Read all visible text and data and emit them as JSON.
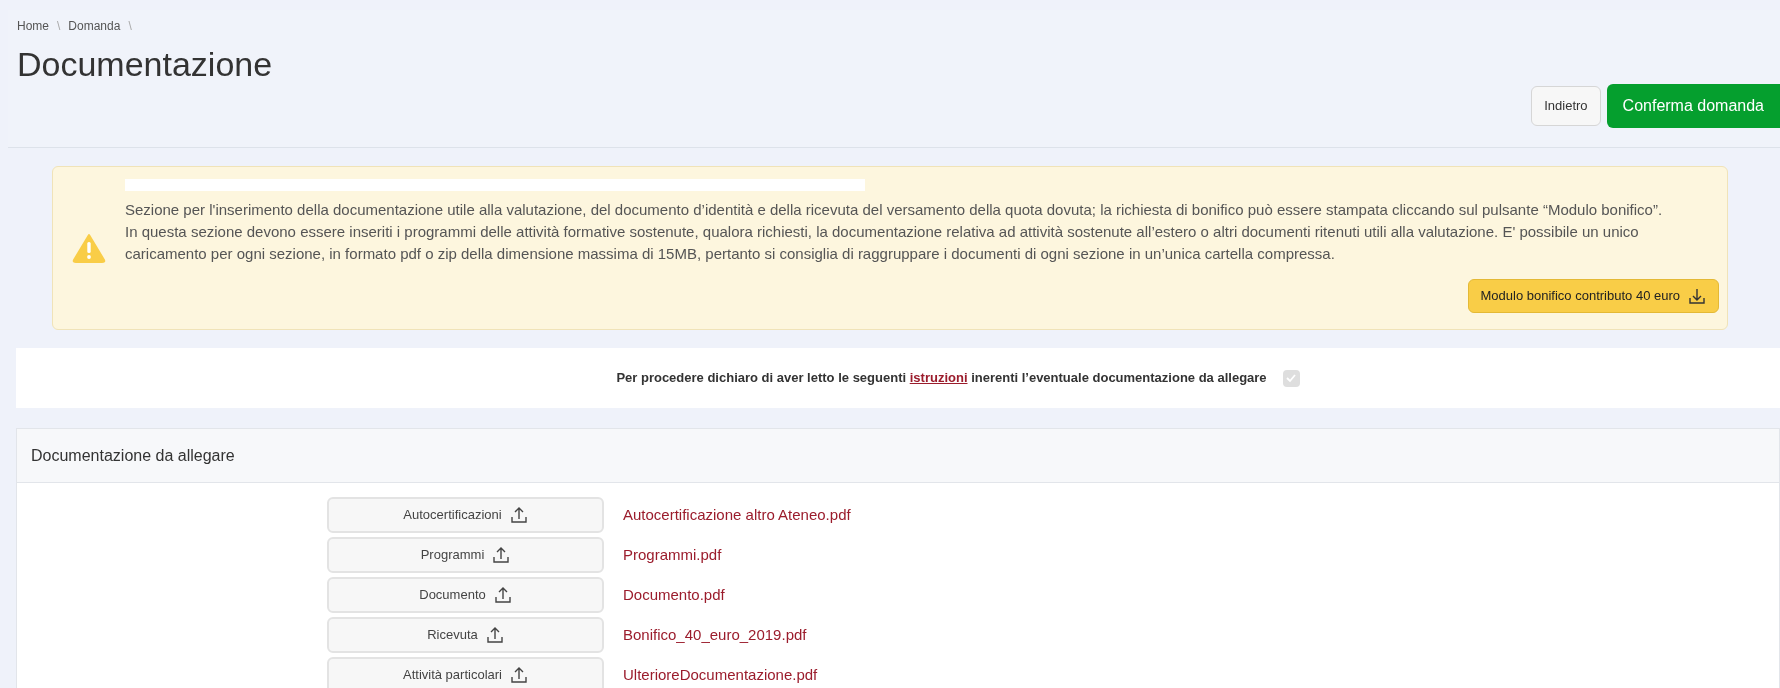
{
  "breadcrumb": {
    "items": [
      "Home",
      "Domanda"
    ],
    "separator": "\\"
  },
  "title": "Documentazione",
  "actions": [
    {
      "label": "Indietro",
      "kind": "secondary"
    },
    {
      "label": "Conferma domanda",
      "kind": "primary"
    }
  ],
  "notice": {
    "paragraphs": [
      "Sezione per l'inserimento della documentazione utile alla valutazione, del documento d’identità e della ricevuta del versamento della quota dovuta; la richiesta di bonifico può essere stampata cliccando sul pulsante “Modulo bonifico”.",
      "In questa sezione devono essere inseriti i programmi delle attività formative sostenute, qualora richiesti, la documentazione relativa ad attività sostenute all’estero o altri documenti ritenuti utili alla valutazione. E' possibile un unico caricamento per ogni sezione, in formato pdf o zip della dimensione massima di 15MB, pertanto si consiglia di raggruppare i documenti di ogni sezione in un’unica cartella compressa."
    ],
    "button": "Modulo bonifico contributo 40 euro"
  },
  "declaration": {
    "before": "Per procedere dichiaro di aver letto le seguenti",
    "link": "istruzioni",
    "after": "inerenti l’eventuale documentazione da allegare",
    "checked": true
  },
  "attachments": {
    "title": "Documentazione da allegare",
    "items": [
      {
        "button": "Autocertificazioni",
        "file": "Autocertificazione altro Ateneo.pdf"
      },
      {
        "button": "Programmi",
        "file": "Programmi.pdf"
      },
      {
        "button": "Documento",
        "file": "Documento.pdf"
      },
      {
        "button": "Ricevuta",
        "file": "Bonifico_40_euro_2019.pdf"
      },
      {
        "button": "Attività particolari",
        "file": "UlterioreDocumentazione.pdf"
      }
    ]
  }
}
